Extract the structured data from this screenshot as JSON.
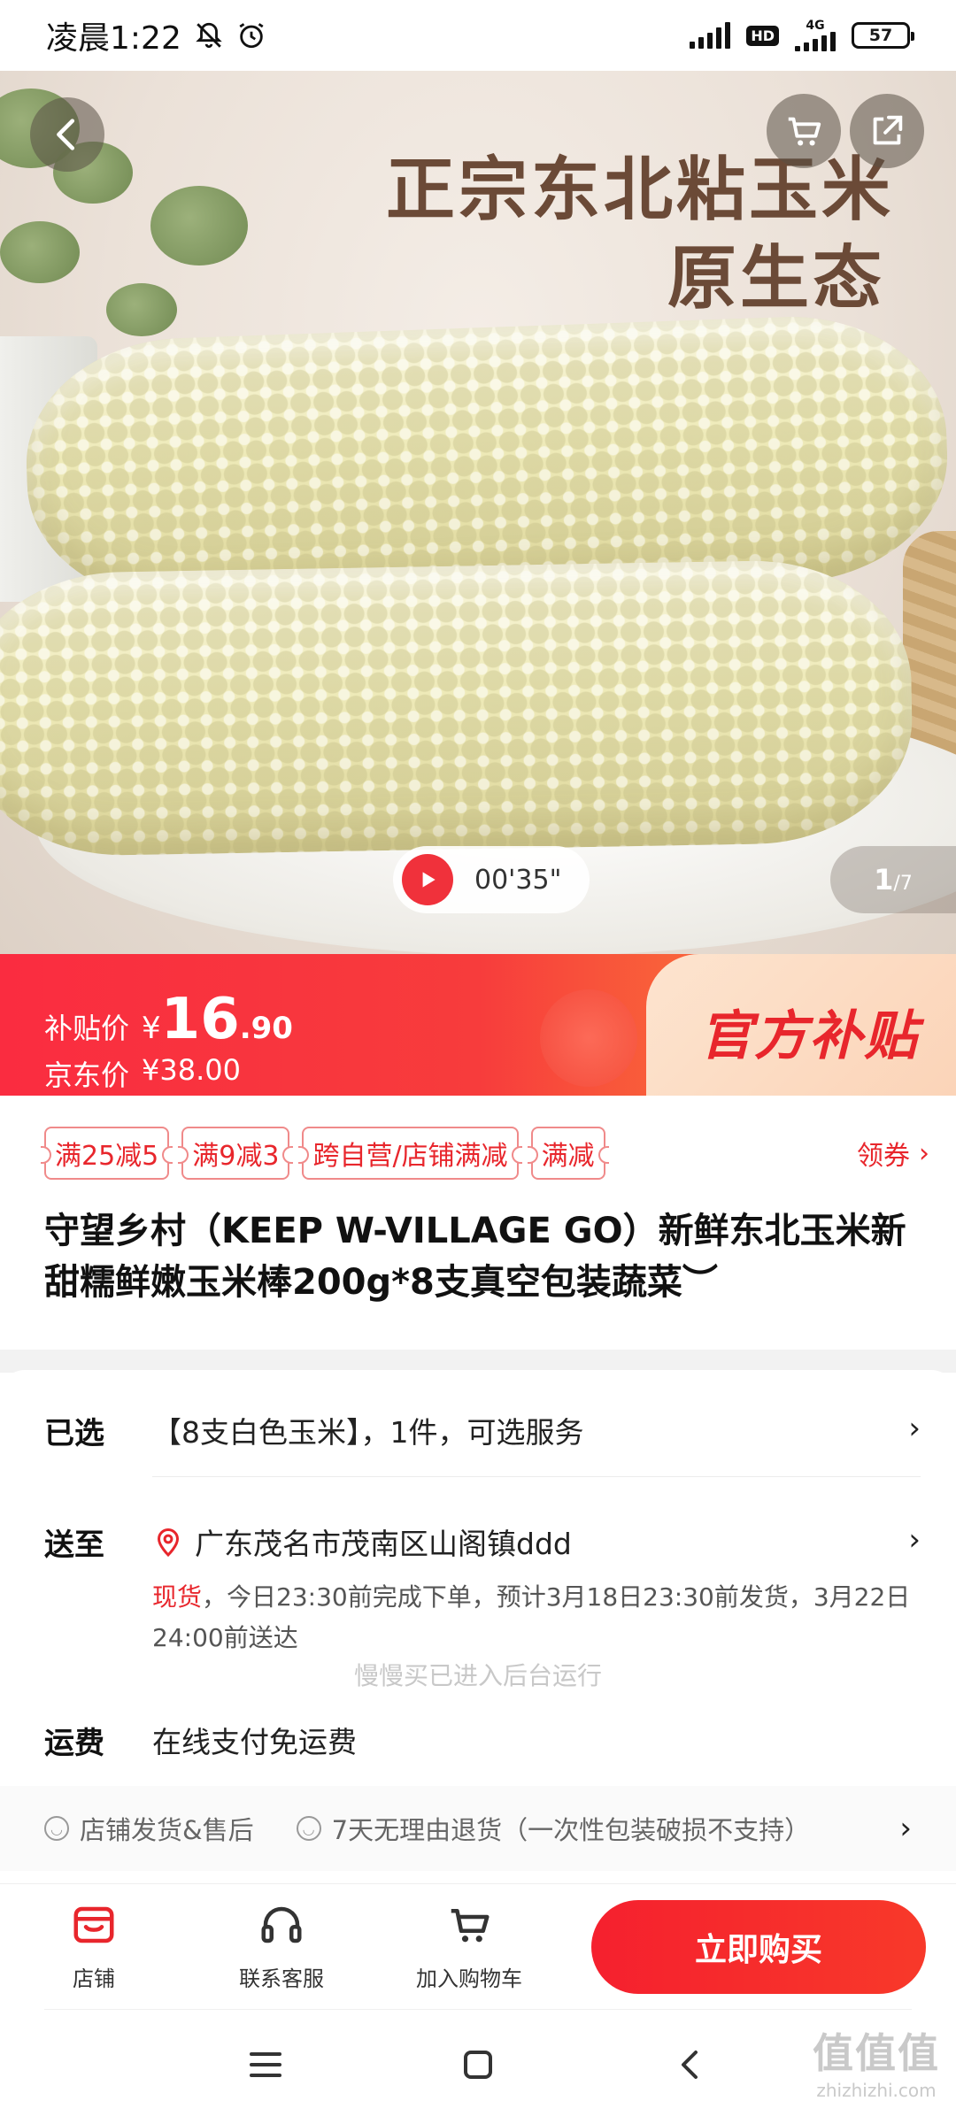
{
  "status_bar": {
    "time": "凌晨1:22",
    "battery": "57",
    "network": "4G",
    "hd": "HD"
  },
  "hero": {
    "headline_1": "正宗东北粘玉米",
    "headline_2": "原生态",
    "video_time": "00'35\"",
    "page_current": "1",
    "page_total": "/7"
  },
  "price": {
    "subsidy_label": "补贴价",
    "currency": "¥",
    "price_int": "16",
    "price_dec": ".90",
    "jd_label": "京东价",
    "jd_price": "¥38.00",
    "subsidy_title": "官方补贴"
  },
  "coupons": {
    "items": [
      "满25减5",
      "满9减3",
      "跨自营/店铺满减",
      "满减"
    ],
    "get_label": "领券",
    "get_chevron": "›"
  },
  "product": {
    "title": "守望乡村（KEEP W-VILLAGE GO）新鲜东北玉米新甜糯鲜嫩玉米棒200g*8支真空包装蔬菜︶"
  },
  "selected": {
    "label": "已选",
    "value": "【8支白色玉米】，1件，可选服务"
  },
  "delivery": {
    "label": "送至",
    "address": "广东茂名市茂南区山阁镇ddd",
    "stock": "现货",
    "note": "，今日23:30前完成下单，预计3月18日23:30前发货，3月22日24:00前送达"
  },
  "toast": "慢慢买已进入后台运行",
  "shipping": {
    "label": "运费",
    "value": "在线支付免运费"
  },
  "guarantees": [
    "店铺发货&售后",
    "7天无理由退货（一次性包装破损不支持）"
  ],
  "actions": {
    "shop": "店铺",
    "service": "联系客服",
    "cart": "加入购物车",
    "buy": "立即购买"
  },
  "chevron": "›",
  "watermark": {
    "logo": "值值值",
    "text": "zhizhizhi.com"
  },
  "colors": {
    "accent": "#f5202e",
    "brand_red": "#e8262c",
    "title_brown": "#6b4a37"
  }
}
